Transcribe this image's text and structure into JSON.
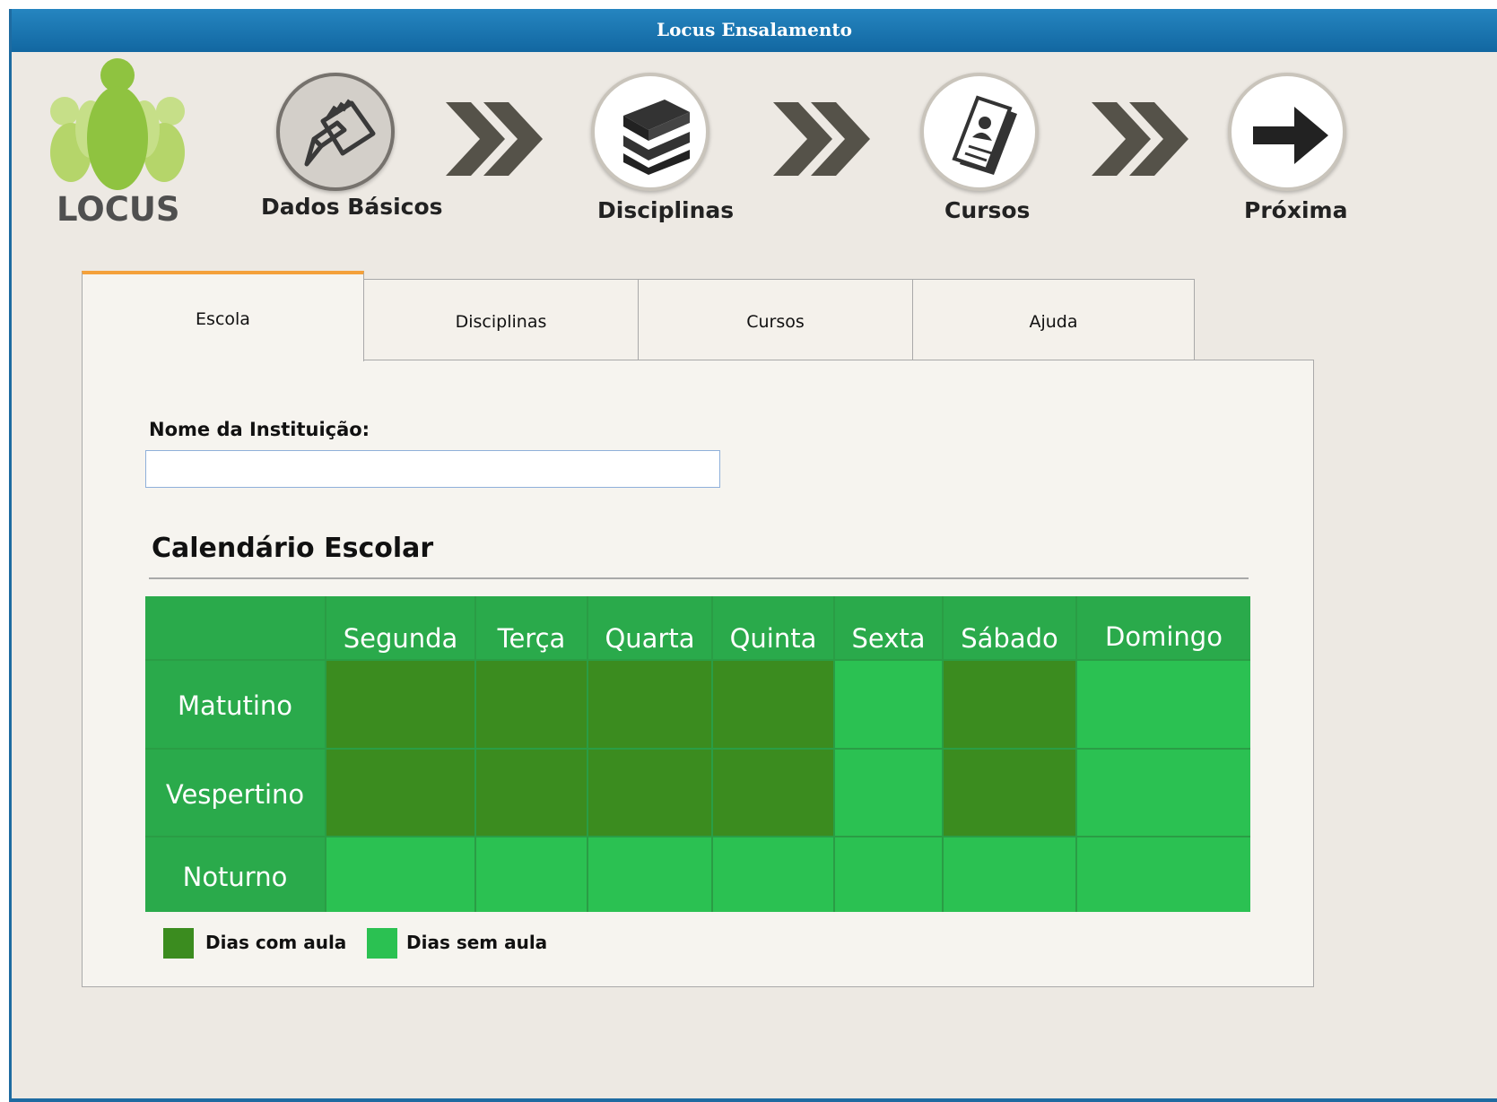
{
  "window": {
    "title": "Locus Ensalamento"
  },
  "logo": {
    "text": "LOCUS"
  },
  "wizard": {
    "steps": [
      {
        "label": "Dados Básicos",
        "icon": "notepad-pencil-icon",
        "active": true
      },
      {
        "label": "Disciplinas",
        "icon": "books-icon",
        "active": false
      },
      {
        "label": "Cursos",
        "icon": "student-id-cards-icon",
        "active": false
      },
      {
        "label": "Próxima",
        "icon": "arrow-right-icon",
        "active": false
      }
    ],
    "separator_icon": "double-chevron-right-icon"
  },
  "tabs": [
    {
      "label": "Escola",
      "active": true
    },
    {
      "label": "Disciplinas",
      "active": false
    },
    {
      "label": "Cursos",
      "active": false
    },
    {
      "label": "Ajuda",
      "active": false
    }
  ],
  "form": {
    "institution_label": "Nome da Instituição:",
    "institution_value": "",
    "institution_placeholder": ""
  },
  "calendar": {
    "title": "Calendário Escolar",
    "days": [
      "Segunda",
      "Terça",
      "Quarta",
      "Quinta",
      "Sexta",
      "Sábado",
      "Domingo"
    ],
    "shifts": [
      {
        "label": "Matutino",
        "classes": [
          true,
          true,
          true,
          true,
          false,
          true,
          false
        ]
      },
      {
        "label": "Vespertino",
        "classes": [
          true,
          true,
          true,
          true,
          false,
          true,
          false
        ]
      },
      {
        "label": "Noturno",
        "classes": [
          false,
          false,
          false,
          false,
          false,
          false,
          false
        ]
      }
    ],
    "colors": {
      "with_class": "#3b8c1f",
      "without_class": "#2bc152",
      "header": "#2aaa4b"
    }
  },
  "legend": {
    "with_class": "Dias com aula",
    "without_class": "Dias sem aula"
  }
}
